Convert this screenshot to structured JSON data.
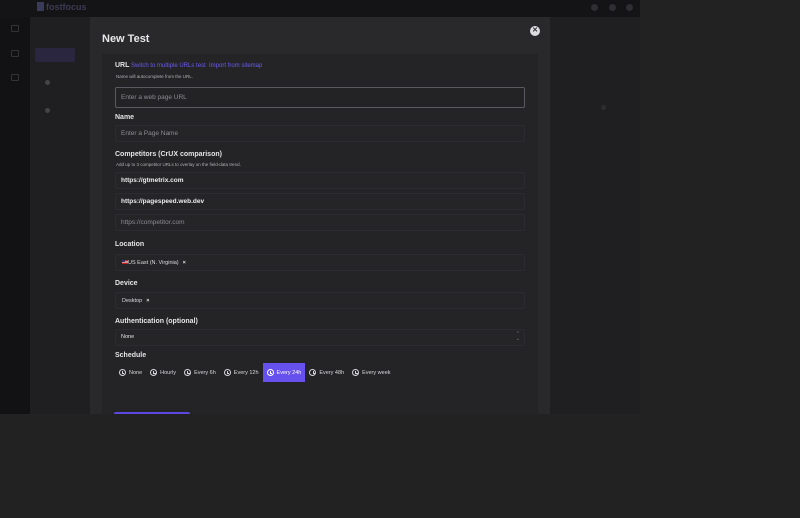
{
  "background_app": {
    "logo_text": "fostfocus"
  },
  "modal": {
    "title": "New Test",
    "url": {
      "label": "URL",
      "switch_link": "Switch to multiple URLs test",
      "import_link": "Import from sitemap",
      "hint": "Name will autocomplete from the URL.",
      "placeholder": "Enter a web page URL",
      "value": ""
    },
    "name": {
      "label": "Name",
      "placeholder": "Enter a Page Name",
      "value": ""
    },
    "competitors": {
      "label": "Competitors (CrUX comparison)",
      "hint": "Add up to 3 competitor URLs to overlay on the field-data trend.",
      "values": [
        "https://gtmetrix.com",
        "https://pagespeed.web.dev"
      ],
      "placeholder": "https://competitor.com"
    },
    "location": {
      "label": "Location",
      "selected": "US East (N. Virginia)",
      "remove": "×"
    },
    "device": {
      "label": "Device",
      "selected": "Desktop",
      "remove": "×"
    },
    "authentication": {
      "label": "Authentication (optional)",
      "selected": "None"
    },
    "schedule": {
      "label": "Schedule",
      "options": [
        "None",
        "Hourly",
        "Every 6h",
        "Every 12h",
        "Every 24h",
        "Every 48h",
        "Every week"
      ],
      "selected": "Every 24h"
    },
    "colors": {
      "accent": "#6650ee",
      "link": "#6a5cf0"
    }
  }
}
